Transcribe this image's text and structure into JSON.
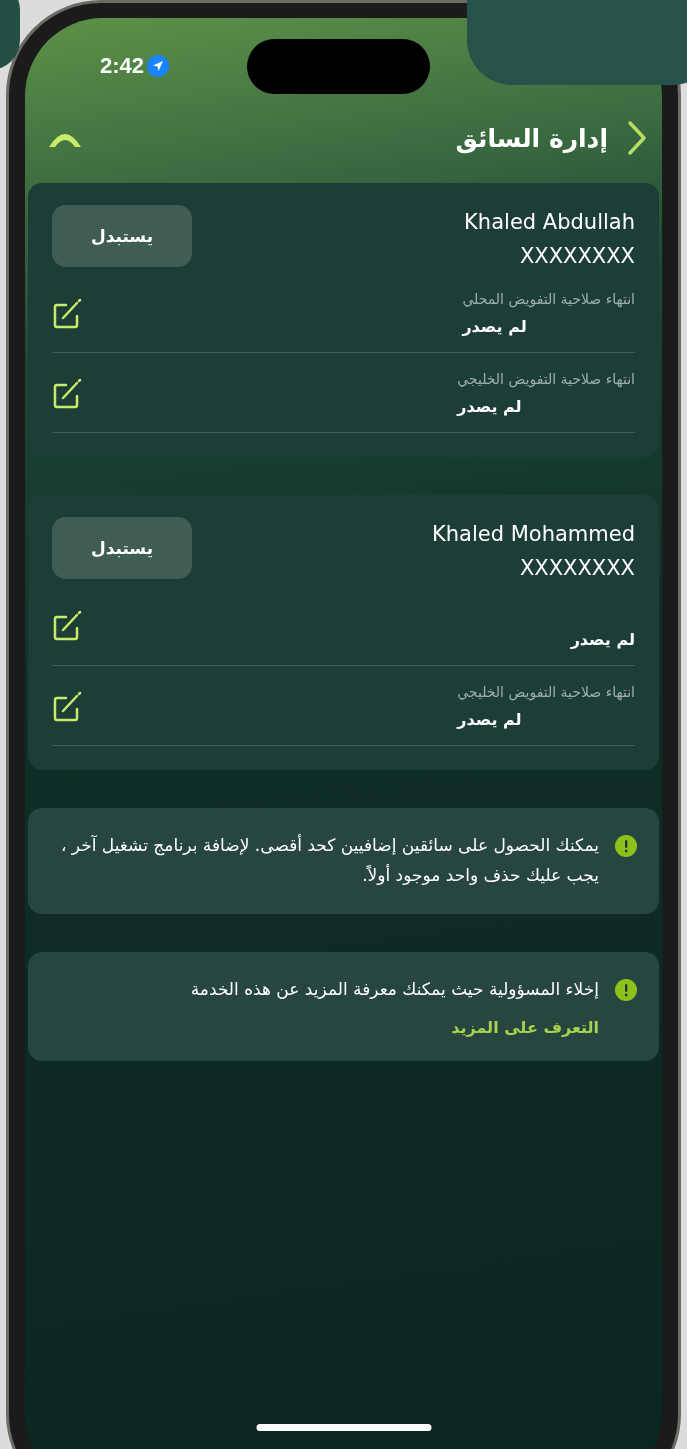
{
  "status_bar": {
    "time": "2:42"
  },
  "header": {
    "title": "إدارة السائق"
  },
  "drivers": [
    {
      "name": "Khaled Abdullah",
      "id": "XXXXXXXX",
      "action": "يستبدل",
      "fields": [
        {
          "label": "انتهاء صلاحية التفويض المحلي",
          "value": "لم يصدر"
        },
        {
          "label": "انتهاء صلاحية التفويض الخليجي",
          "value": "لم يصدر"
        }
      ]
    },
    {
      "name": "Khaled Mohammed",
      "id": "XXXXXXXX",
      "action": "يستبدل",
      "fields": [
        {
          "value": "لم يصدر"
        },
        {
          "label": "انتهاء صلاحية التفويض الخليجي",
          "value": "لم يصدر"
        }
      ]
    }
  ],
  "notices": [
    {
      "text": "يمكنك الحصول على سائقين إضافيين كحد أقصى. لإضافة برنامج تشغيل آخر ، يجب عليك حذف واحد موجود أولاً."
    },
    {
      "text": "إخلاء المسؤولية حيث يمكنك معرفة المزيد عن هذه الخدمة",
      "link": "التعرف على المزيد"
    }
  ]
}
